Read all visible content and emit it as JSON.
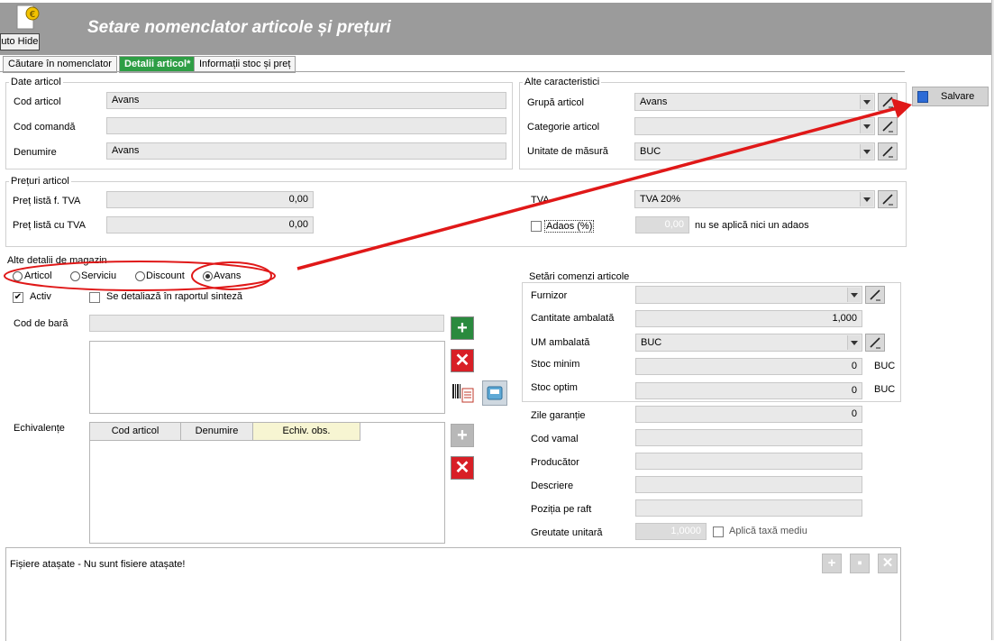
{
  "header": {
    "title": "Setare nomenclator articole și prețuri",
    "auto_hide_label": "Auto Hide"
  },
  "tabs": [
    {
      "label": "Căutare în nomenclator",
      "active": false
    },
    {
      "label": "Detalii articol*",
      "active": true
    },
    {
      "label": "Informații stoc și preț",
      "active": false
    }
  ],
  "save_button": {
    "label": "Salvare"
  },
  "date_articol": {
    "legend": "Date articol",
    "cod_articol_label": "Cod articol",
    "cod_articol_value": "Avans",
    "cod_comanda_label": "Cod comandă",
    "cod_comanda_value": "",
    "denumire_label": "Denumire",
    "denumire_value": "Avans"
  },
  "alte_caracteristici": {
    "legend": "Alte caracteristici",
    "grupa_label": "Grupă articol",
    "grupa_value": "Avans",
    "categorie_label": "Categorie articol",
    "categorie_value": "",
    "unitate_label": "Unitate de măsură",
    "unitate_value": "BUC"
  },
  "preturi": {
    "legend": "Prețuri articol",
    "fara_tva_label": "Preț listă f. TVA",
    "fara_tva_value": "0,00",
    "cu_tva_label": "Preț listă cu TVA",
    "cu_tva_value": "0,00",
    "tva_label": "TVA",
    "tva_value": "TVA 20%",
    "adaos_label": "Adaos (%)",
    "adaos_value": "0,00",
    "adaos_note": "nu se aplică nici un adaos"
  },
  "magazin": {
    "legend": "Alte detalii de magazin",
    "radios": [
      {
        "label": "Articol",
        "selected": false
      },
      {
        "label": "Serviciu",
        "selected": false
      },
      {
        "label": "Discount",
        "selected": false
      },
      {
        "label": "Avans",
        "selected": true
      }
    ],
    "activ_label": "Activ",
    "activ_checked": true,
    "detaliaza_label": "Se detaliază în raportul sinteză",
    "detaliaza_checked": false,
    "cod_bara_label": "Cod de bară",
    "cod_bara_value": "",
    "echivalente_label": "Echivalențe",
    "echivalente_columns": [
      "Cod articol",
      "Denumire",
      "Echiv. obs."
    ]
  },
  "comenzi": {
    "legend": "Setări comenzi articole",
    "furnizor_label": "Furnizor",
    "furnizor_value": "",
    "cantitate_label": "Cantitate ambalată",
    "cantitate_value": "1,000",
    "um_label": "UM ambalată",
    "um_value": "BUC",
    "stoc_minim_label": "Stoc minim",
    "stoc_minim_value": "0",
    "stoc_minim_unit": "BUC",
    "stoc_optim_label": "Stoc optim",
    "stoc_optim_value": "0",
    "stoc_optim_unit": "BUC"
  },
  "extra": {
    "zile_garantie_label": "Zile garanție",
    "zile_garantie_value": "0",
    "cod_vamal_label": "Cod vamal",
    "cod_vamal_value": "",
    "producator_label": "Producător",
    "producator_value": "",
    "descriere_label": "Descriere",
    "descriere_value": "",
    "pozitia_label": "Poziția pe raft",
    "pozitia_value": "",
    "greutate_label": "Greutate unitară",
    "greutate_value": "1,0000",
    "taxa_mediu_label": "Aplică taxă mediu"
  },
  "atasamente": {
    "text": "Fișiere atașate - Nu sunt fisiere atașate!"
  },
  "colors": {
    "annotation_red": "#e01818",
    "active_tab": "#2e9e45",
    "header_bg": "#9b9b9b"
  }
}
